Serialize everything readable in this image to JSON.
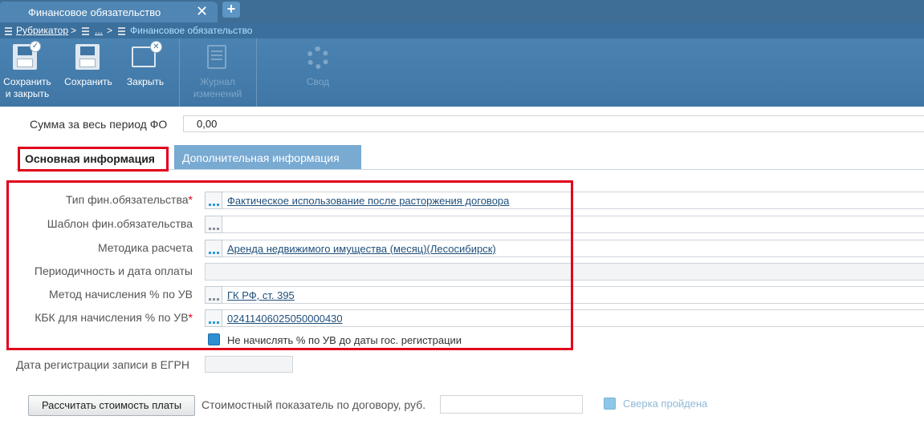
{
  "window": {
    "tab_title": "Финансовое обязательство",
    "close_glyph": "✕",
    "add_glyph": "+"
  },
  "breadcrumb": {
    "root": "Рубрикатор",
    "sep": ">",
    "middle": "...",
    "current": "Финансовое обязательство"
  },
  "toolbar": {
    "save_close_line1": "Сохранить",
    "save_close_line2": "и закрыть",
    "save": "Сохранить",
    "close": "Закрыть",
    "journal_line1": "Журнал",
    "journal_line2": "изменений",
    "svod": "Свод"
  },
  "summary": {
    "label": "Сумма за весь период ФО",
    "value": "0,00"
  },
  "tabs": {
    "main": "Основная информация",
    "extra": "Дополнительная информация"
  },
  "form": {
    "type_label": "Тип фин.обязательства",
    "type_value": "Фактическое использование после расторжения договора",
    "template_label": "Шаблон фин.обязательства",
    "template_value": "",
    "method_label": "Методика расчета",
    "method_value": "Аренда недвижимого имущества (месяц)(Лесосибирск)",
    "periodicity_label": "Периодичность и дата оплаты",
    "accrual_label": "Метод начисления % по УВ",
    "accrual_value": "ГК РФ, ст. 395",
    "kbk_label": "КБК для начисления % по УВ",
    "kbk_value": "02411406025050000430",
    "required_mark": "*",
    "no_accrual_checkbox": "Не начислять % по УВ до даты гос. регистрации",
    "egrn_label": "Дата регистрации записи в ЕГРН"
  },
  "footer": {
    "calc_button": "Рассчитать стоимость платы",
    "cost_label": "Стоимостный показатель по договору, руб.",
    "verified_label": "Сверка пройдена"
  },
  "colors": {
    "header_blue": "#3e6d96",
    "toolbar_blue": "#4a83b2",
    "highlight_red": "#e0001b",
    "link_blue": "#1f4f7a"
  }
}
